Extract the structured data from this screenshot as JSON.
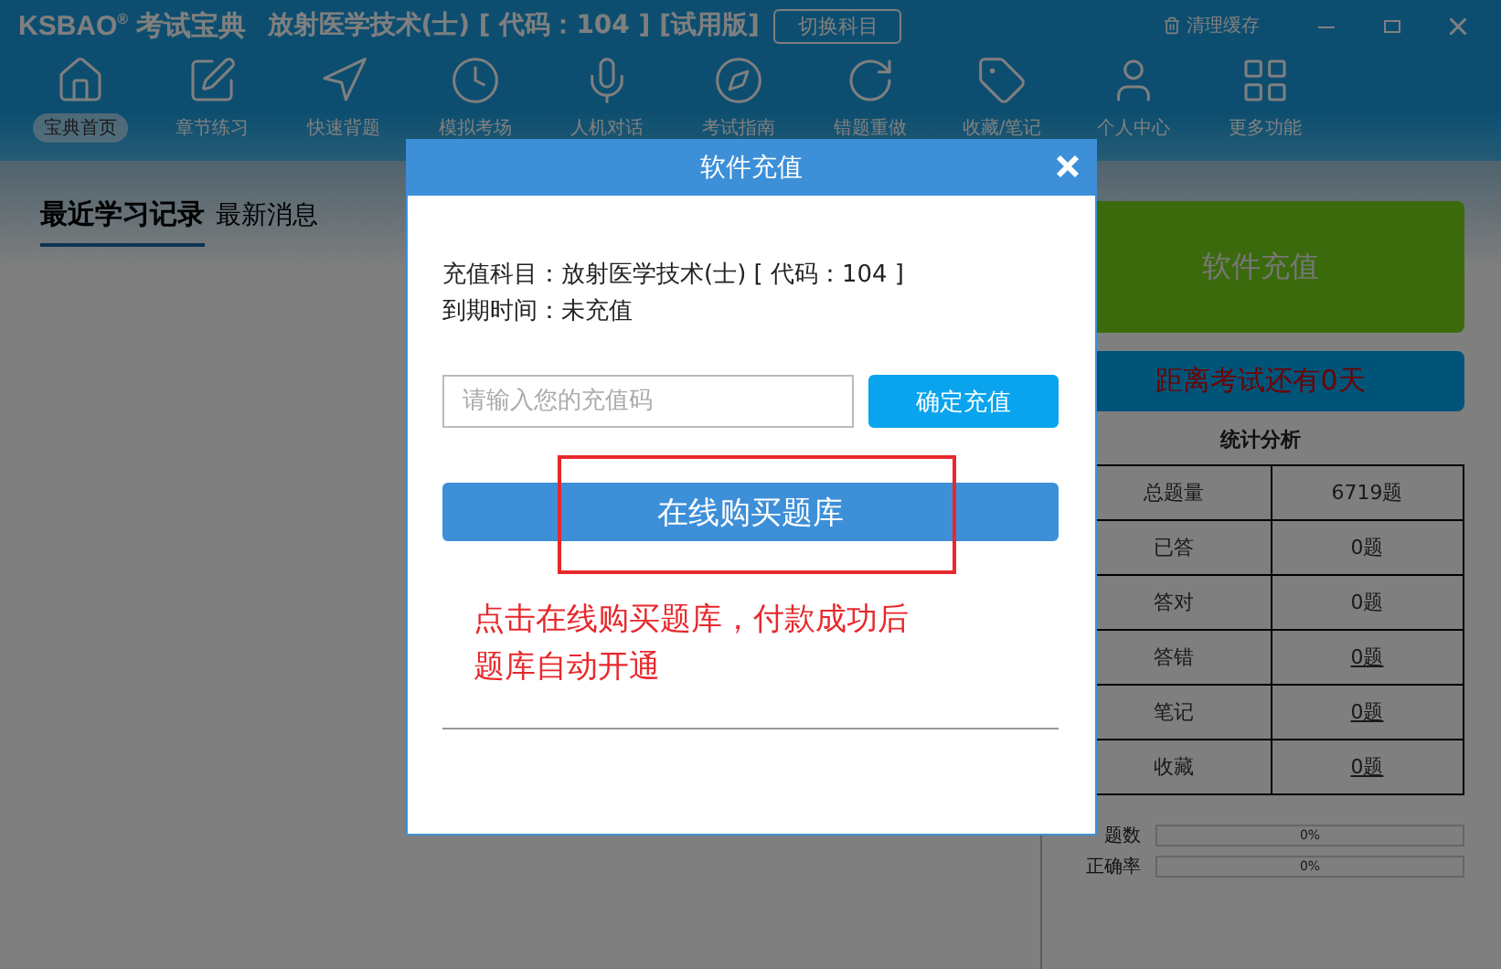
{
  "app": {
    "logo": "KSBAO",
    "logo_mark": "®",
    "logo_cn": "考试宝典",
    "subject": "放射医学技术(士) [ 代码：104 ] [试用版]",
    "switch_button": "切换科目",
    "clear_cache": "清理缓存"
  },
  "nav": [
    {
      "label": "宝典首页",
      "selected": true
    },
    {
      "label": "章节练习",
      "selected": false
    },
    {
      "label": "快速背题",
      "selected": false
    },
    {
      "label": "模拟考场",
      "selected": false
    },
    {
      "label": "人机对话",
      "selected": false
    },
    {
      "label": "考试指南",
      "selected": false
    },
    {
      "label": "错题重做",
      "selected": false
    },
    {
      "label": "收藏/笔记",
      "selected": false
    },
    {
      "label": "个人中心",
      "selected": false
    },
    {
      "label": "更多功能",
      "selected": false
    }
  ],
  "tabs": [
    {
      "label": "最近学习记录",
      "selected": true
    },
    {
      "label": "最新消息",
      "selected": false
    }
  ],
  "recharge_button": "软件充值",
  "countdown": "距离考试还有0天",
  "stats": {
    "title": "统计分析",
    "rows": [
      {
        "label": "总题量",
        "value": "6719题",
        "link": false
      },
      {
        "label": "已答",
        "value": "0题",
        "link": false
      },
      {
        "label": "答对",
        "value": "0题",
        "link": false
      },
      {
        "label": "答错",
        "value": "0题",
        "link": true
      },
      {
        "label": "笔记",
        "value": "0题",
        "link": true
      },
      {
        "label": "收藏",
        "value": "0题",
        "link": true
      }
    ]
  },
  "progress": [
    {
      "label": "题数",
      "level": 0,
      "reading": "0%"
    },
    {
      "label": "正确率",
      "level": 0,
      "reading": "0%"
    }
  ],
  "dialog": {
    "title": "软件充值",
    "lines": [
      "充值科目：放射医学技术(士) [ 代码：104 ]",
      "到期时间：未充值"
    ],
    "code_placeholder": "请输入您的充值码",
    "confirm_button": "确定充值",
    "buy_button": "在线购买题库",
    "annotation": "点击在线购买题库，付款成功后题库自动开通"
  }
}
